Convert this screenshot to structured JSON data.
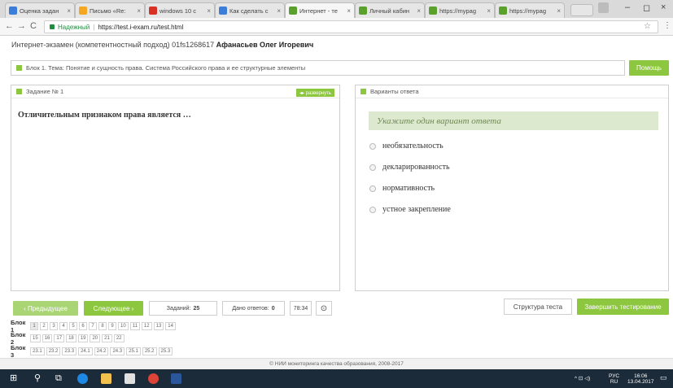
{
  "browser": {
    "tabs": [
      {
        "label": "Оценка задан",
        "color": "#3b7dd8"
      },
      {
        "label": "Письмо «Re:",
        "color": "#f5a623"
      },
      {
        "label": "windows 10 c",
        "color": "#d93025"
      },
      {
        "label": "Как сделать с",
        "color": "#3b7dd8"
      },
      {
        "label": "Интернет - те",
        "color": "#5aa02c"
      },
      {
        "label": "Личный кабин",
        "color": "#5aa02c"
      },
      {
        "label": "https://mypag",
        "color": "#5aa02c"
      },
      {
        "label": "https://mypag",
        "color": "#5aa02c"
      }
    ],
    "tab_close": "×",
    "nav": {
      "back": "←",
      "forward": "→",
      "reload": "C"
    },
    "secure_label": "Надежный",
    "url": "https://test.i-exam.ru/test.html",
    "star": "☆",
    "menu": "⋮",
    "window": {
      "minimize": "–",
      "maximize": "◻",
      "close": "×"
    }
  },
  "header": {
    "exam": "Интернет-экзамен (компетентностный подход) 01fs1268617",
    "student": "Афанасьев Олег Игоревич"
  },
  "topic": "Блок 1. Тема: Понятие и сущность права. Система Российского права и ее структурные элементы",
  "help_label": "Помощь",
  "task": {
    "label": "Задание № 1",
    "expand_label": "◂▸ развернуть",
    "question": "Отличительным признаком права является …"
  },
  "answers": {
    "label": "Варианты ответа",
    "hint": "Укажите один вариант ответа",
    "options": [
      "необязательность",
      "декларированность",
      "нормативность",
      "устное закрепление"
    ]
  },
  "controls": {
    "prev": "‹ Предыдущее",
    "next": "Следующее ›",
    "tasks_label": "Заданий:",
    "tasks_value": "25",
    "answered_label": "Дано ответов:",
    "answered_value": "0",
    "timer": "78:34",
    "settings_icon": "⊙",
    "structure": "Структура теста",
    "finish": "Завершить тестирование"
  },
  "blocks": [
    {
      "label": "Блок 1",
      "cells": [
        "1",
        "2",
        "3",
        "4",
        "5",
        "6",
        "7",
        "8",
        "9",
        "10",
        "11",
        "12",
        "13",
        "14"
      ]
    },
    {
      "label": "Блок 2",
      "cells": [
        "15",
        "16",
        "17",
        "18",
        "19",
        "20",
        "21",
        "22"
      ]
    },
    {
      "label": "Блок 3",
      "cells": [
        "23.1",
        "23.2",
        "23.3",
        "24.1",
        "24.2",
        "24.3",
        "25.1",
        "25.2",
        "25.3"
      ]
    }
  ],
  "footer": "© НИИ мониторинга качества образования, 2008-2017",
  "taskbar": {
    "start": "⊞",
    "search": "⚲",
    "taskview": "⧉",
    "lang_top": "РУС",
    "lang_bottom": "RU",
    "time": "16:06",
    "date": "13.04.2017",
    "tray_icons": "^ ⊡ ◁)",
    "notify": "▭"
  }
}
